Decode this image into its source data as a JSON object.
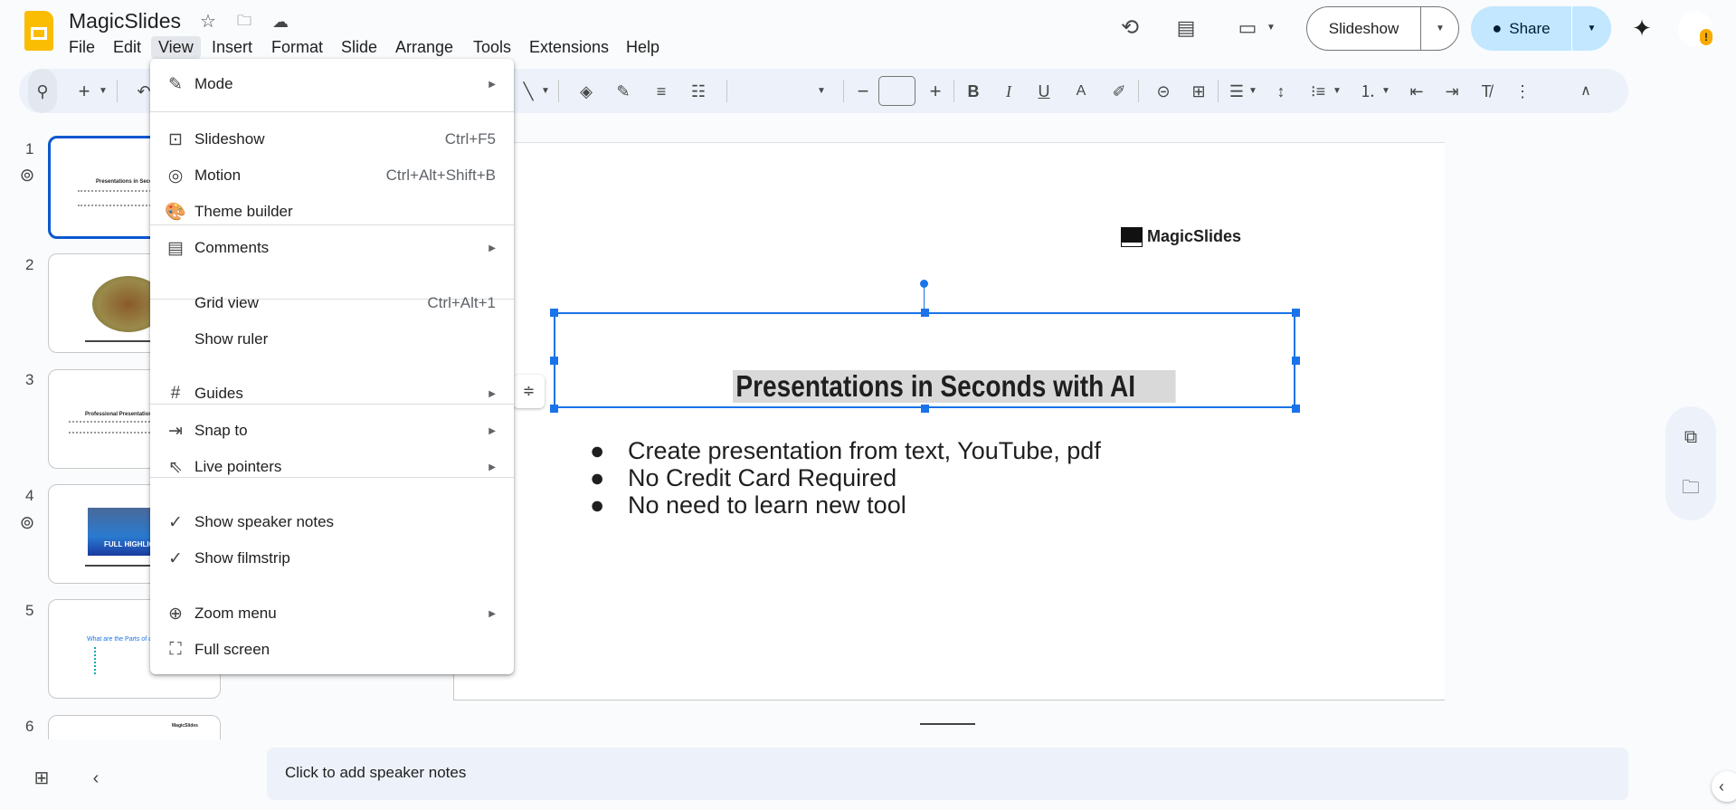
{
  "app": {
    "title": "MagicSlides"
  },
  "menubar": [
    "File",
    "Edit",
    "View",
    "Insert",
    "Format",
    "Slide",
    "Arrange",
    "Tools",
    "Extensions",
    "Help"
  ],
  "header": {
    "slideshow_label": "Slideshow",
    "share_label": "Share",
    "share_color": "#c2e7ff"
  },
  "view_menu": {
    "items": [
      {
        "icon": "pencil-icon",
        "label": "Mode",
        "shortcut": "",
        "submenu": true
      },
      {
        "icon": "play-box-icon",
        "label": "Slideshow",
        "shortcut": "Ctrl+F5",
        "submenu": false
      },
      {
        "icon": "motion-icon",
        "label": "Motion",
        "shortcut": "Ctrl+Alt+Shift+B",
        "submenu": false
      },
      {
        "icon": "palette-icon",
        "label": "Theme builder",
        "shortcut": "",
        "submenu": false
      },
      {
        "icon": "comments-icon",
        "label": "Comments",
        "shortcut": "",
        "submenu": true
      },
      {
        "icon": "",
        "label": "Grid view",
        "shortcut": "Ctrl+Alt+1",
        "submenu": false
      },
      {
        "icon": "",
        "label": "Show ruler",
        "shortcut": "",
        "submenu": false
      },
      {
        "icon": "grid-hash-icon",
        "label": "Guides",
        "shortcut": "",
        "submenu": true
      },
      {
        "icon": "snap-arrow-icon",
        "label": "Snap to",
        "shortcut": "",
        "submenu": true
      },
      {
        "icon": "live-pointer-icon",
        "label": "Live pointers",
        "shortcut": "",
        "submenu": true
      },
      {
        "icon": "check-icon",
        "label": "Show speaker notes",
        "shortcut": "",
        "submenu": false,
        "checked": true
      },
      {
        "icon": "check-icon",
        "label": "Show filmstrip",
        "shortcut": "",
        "submenu": false,
        "checked": true
      },
      {
        "icon": "zoom-in-icon",
        "label": "Zoom menu",
        "shortcut": "",
        "submenu": true
      },
      {
        "icon": "fullscreen-icon",
        "label": "Full screen",
        "shortcut": "",
        "submenu": false
      }
    ]
  },
  "filmstrip": {
    "slides": [
      {
        "num": "1",
        "title": "Presentations in Seconds w"
      },
      {
        "num": "2"
      },
      {
        "num": "3",
        "title": "Professional Presentations in S"
      },
      {
        "num": "4",
        "banner": "FULL HIGHLIG"
      },
      {
        "num": "5",
        "title": "What are the Parts of a W"
      },
      {
        "num": "6",
        "logo": "MagicSlides"
      }
    ]
  },
  "slide": {
    "logo": "MagicSlides",
    "title": "Presentations in Seconds with AI",
    "bullets": [
      "Create presentation from text, YouTube, pdf",
      "No Credit Card Required",
      "No need to learn new tool"
    ]
  },
  "notes": {
    "placeholder": "Click to add speaker notes"
  },
  "accent": "#0b57d0"
}
